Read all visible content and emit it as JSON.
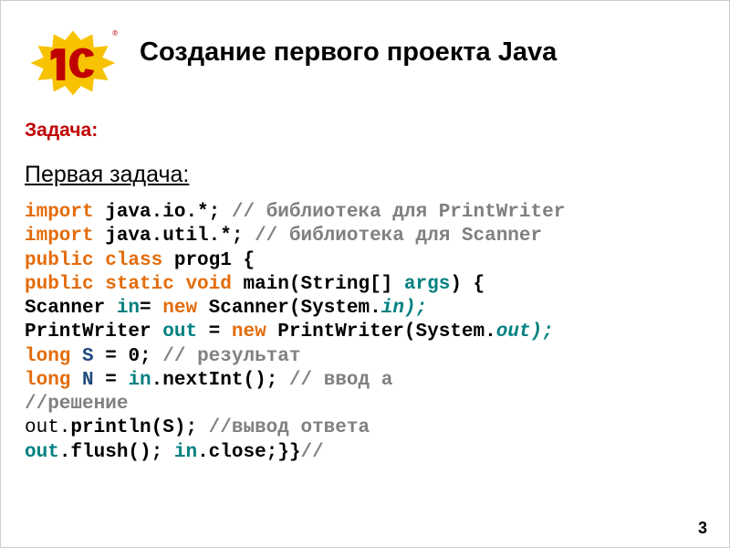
{
  "logo_trademark": "®",
  "title": "Создание первого проекта Java",
  "task_label": "Задача:",
  "subtitle": "Первая задача:",
  "code": {
    "l1": {
      "kw": "import",
      "pkg": " java.io.*; ",
      "cmt": "// библиотека для PrintWriter"
    },
    "l2": {
      "kw": "import",
      "pkg": " java.util.*; ",
      "cmt": "// библиотека для Scanner"
    },
    "l3": {
      "a": "public",
      "b": " class",
      "c": " prog1 {"
    },
    "l4": {
      "a": "public",
      "b": " static",
      "c": " void",
      "d": " main(String[] ",
      "e": "args",
      "f": ") {"
    },
    "l5": {
      "a": "Scanner ",
      "b": "in",
      "c": "= ",
      "d": "new",
      "e": " Scanner(System.",
      "f": "in",
      "g": ");"
    },
    "l6": {
      "a": "PrintWriter ",
      "b": "out",
      "c": " = ",
      "d": "new",
      "e": " PrintWriter(System.",
      "f": "out",
      "g": ");"
    },
    "l7": {
      "a": "long",
      "b": " S",
      "c": " = 0; ",
      "d": "// результат"
    },
    "l8": {
      "a": "long",
      "b": " N",
      "c": " = ",
      "d": "in",
      "e": ".nextInt(); ",
      "f": "// ввод a"
    },
    "l9": {
      "a": "//решение"
    },
    "l10": {
      "a": "out.",
      "b": "println(S); ",
      "c": "//вывод ответа"
    },
    "l11": {
      "a": "out",
      "b": ".flush(); ",
      "c": "in",
      "d": ".close;}}",
      "e": "//"
    }
  },
  "page_number": "3"
}
